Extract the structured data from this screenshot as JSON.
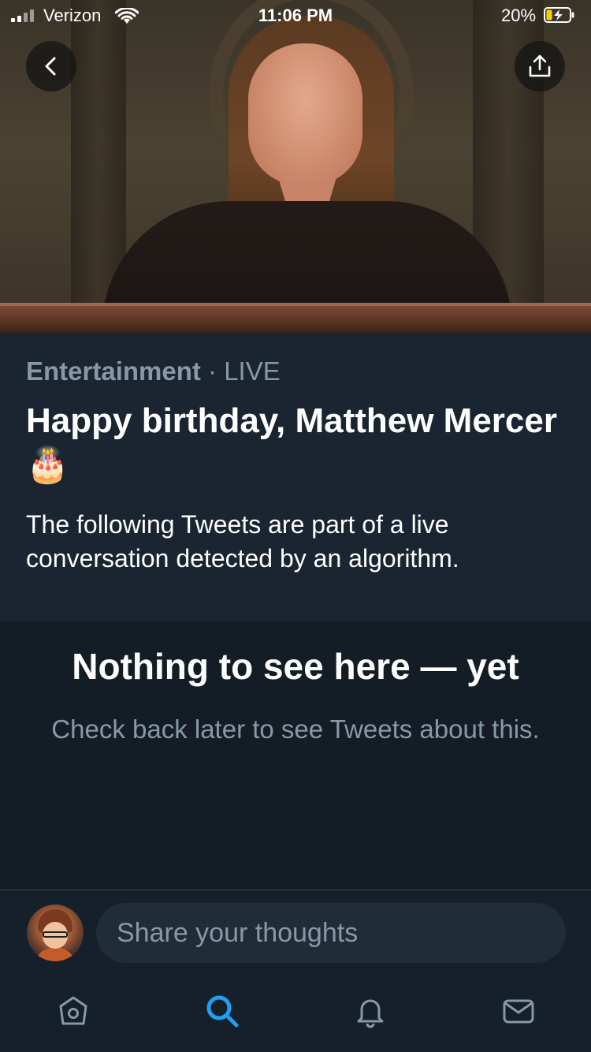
{
  "status_bar": {
    "carrier": "Verizon",
    "time": "11:06 PM",
    "battery_percent": "20%"
  },
  "hero": {
    "back_icon": "chevron-left-icon",
    "share_icon": "share-upload-icon"
  },
  "event": {
    "category": "Entertainment",
    "separator": " · ",
    "status": "LIVE",
    "title": "Happy birthday, Matthew Mercer",
    "title_emoji": "🎂",
    "description": "The following Tweets are part of a live conversation detected by an algorithm."
  },
  "empty_state": {
    "title": "Nothing to see here — yet",
    "subtitle": "Check back later to see Tweets about this."
  },
  "compose": {
    "placeholder": "Share your thoughts"
  },
  "tabs": [
    {
      "name": "home",
      "icon": "home-icon"
    },
    {
      "name": "search",
      "icon": "search-icon",
      "active": true
    },
    {
      "name": "notifications",
      "icon": "bell-icon"
    },
    {
      "name": "messages",
      "icon": "envelope-icon"
    }
  ],
  "colors": {
    "accent": "#1da1f2",
    "background": "#15202b",
    "panel": "#1b2532",
    "muted_text": "#8899a6"
  }
}
